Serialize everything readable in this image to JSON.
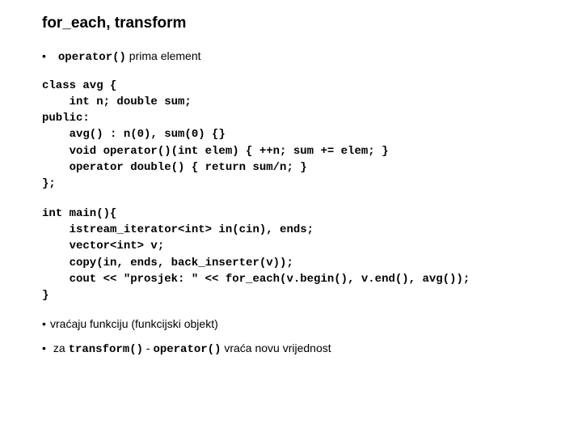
{
  "title": "for_each, transform",
  "bullet1": {
    "code": "operator()",
    "text_after": " prima element"
  },
  "code1": "class avg {\n    int n; double sum;\npublic:\n    avg() : n(0), sum(0) {}\n    void operator()(int elem) { ++n; sum += elem; }\n    operator double() { return sum/n; }\n};",
  "code2": "int main(){\n    istream_iterator<int> in(cin), ends;\n    vector<int> v;\n    copy(in, ends, back_inserter(v));\n    cout << \"prosjek: \" << for_each(v.begin(), v.end(), avg());\n}",
  "bullet2": "vraćaju funkciju (funkcijski objekt)",
  "bullet3": {
    "before": "za ",
    "code1": "transform()",
    "mid": " - ",
    "code2": "operator()",
    "after": " vraća novu vrijednost"
  }
}
